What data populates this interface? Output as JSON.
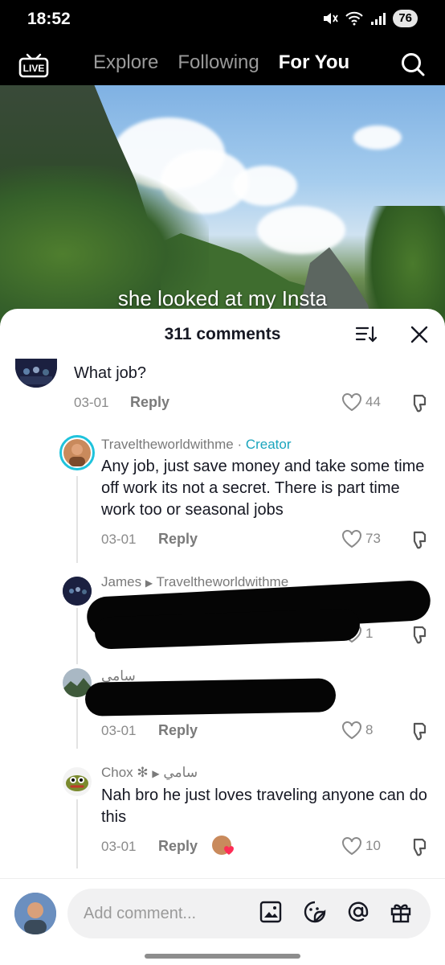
{
  "status_bar": {
    "time": "18:52",
    "battery": "76"
  },
  "nav": {
    "live_label": "LIVE",
    "tabs": [
      {
        "label": "Explore"
      },
      {
        "label": "Following"
      },
      {
        "label": "For You"
      }
    ]
  },
  "video": {
    "caption": "she looked at my Insta"
  },
  "comments_panel": {
    "title": "311 comments",
    "comments": [
      {
        "text": "What job?",
        "date": "03-01",
        "reply_label": "Reply",
        "likes": "44"
      },
      {
        "author": "Traveltheworldwithme",
        "separator": " · ",
        "badge": "Creator",
        "text": "Any job, just save money and take some time off work its not a secret. There is part time work too or seasonal jobs",
        "date": "03-01",
        "reply_label": "Reply",
        "likes": "73"
      },
      {
        "author": "James",
        "reply_to": "Traveltheworldwithme",
        "likes": "1"
      },
      {
        "author": "سامي",
        "date": "03-01",
        "reply_label": "Reply",
        "likes": "8"
      },
      {
        "author": "Chox ✻",
        "reply_to": "سامي",
        "text": "Nah bro he just loves traveling anyone can do this",
        "date": "03-01",
        "reply_label": "Reply",
        "likes": "10"
      }
    ]
  },
  "composer": {
    "placeholder": "Add comment..."
  },
  "colors": {
    "creator": "#1aa5bd",
    "accent_heart": "#fe2c55"
  },
  "icons": [
    "live-icon",
    "search-icon",
    "sort-icon",
    "close-icon",
    "heart-icon",
    "dislike-icon",
    "image-icon",
    "sticker-icon",
    "mention-icon",
    "gift-icon"
  ]
}
